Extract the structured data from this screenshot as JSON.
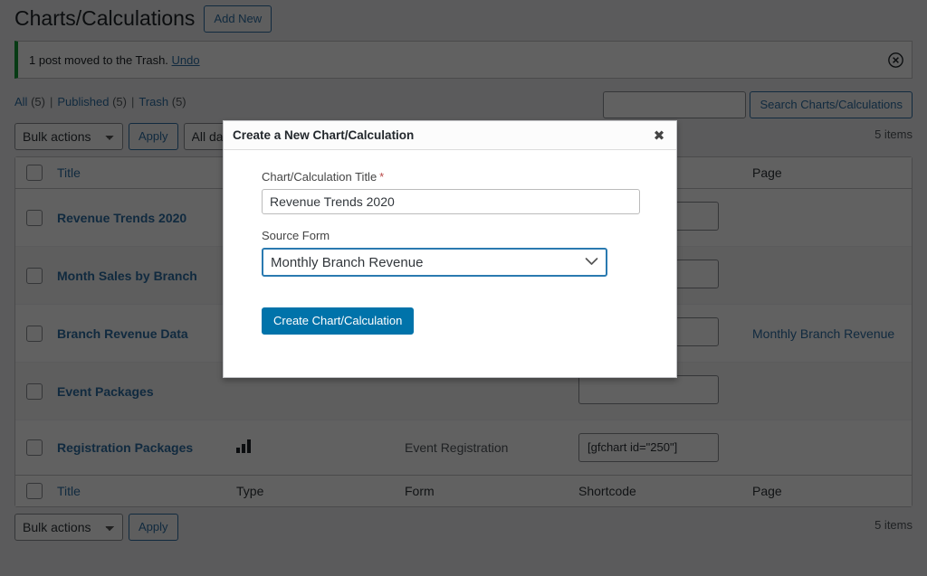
{
  "header": {
    "title": "Charts/Calculations",
    "add_new_label": "Add New"
  },
  "notice": {
    "message": "1 post moved to the Trash.",
    "undo_label": "Undo",
    "dismiss_icon": "dismiss-circle-icon",
    "accent_color": "#00a32a"
  },
  "views": {
    "all_label": "All",
    "all_count": "(5)",
    "published_label": "Published",
    "published_count": "(5)",
    "trash_label": "Trash",
    "trash_count": "(5)",
    "separator": "|"
  },
  "search": {
    "value": "",
    "placeholder": "",
    "button_label": "Search Charts/Calculations"
  },
  "tablenav_top": {
    "bulk_actions_label": "Bulk actions",
    "apply_label": "Apply",
    "dates_label": "All dates",
    "items_count": "5 items"
  },
  "tablenav_bottom": {
    "bulk_actions_label": "Bulk actions",
    "apply_label": "Apply",
    "items_count": "5 items"
  },
  "table": {
    "columns": [
      {
        "key": "title",
        "label": "Title"
      },
      {
        "key": "type",
        "label": "Type"
      },
      {
        "key": "form",
        "label": "Form"
      },
      {
        "key": "shortcode",
        "label": "Shortcode"
      },
      {
        "key": "page",
        "label": "Page"
      }
    ],
    "rows": [
      {
        "title": "Revenue Trends 2020",
        "type_icon": "",
        "form": "",
        "shortcode": "",
        "page": ""
      },
      {
        "title": "Month Sales by Branch",
        "type_icon": "",
        "form": "",
        "shortcode": "",
        "page": ""
      },
      {
        "title": "Branch Revenue Data",
        "type_icon": "",
        "form": "",
        "shortcode": "",
        "page": "Monthly Branch Revenue"
      },
      {
        "title": "Event Packages",
        "type_icon": "",
        "form": "",
        "shortcode": "",
        "page": ""
      },
      {
        "title": "Registration Packages",
        "type_icon": "bar-chart-icon",
        "form": "Event Registration",
        "shortcode": "[gfchart id=\"250\"]",
        "page": ""
      }
    ]
  },
  "modal": {
    "title": "Create a New Chart/Calculation",
    "close_icon": "close-icon",
    "title_field": {
      "label": "Chart/Calculation Title",
      "required_marker": "*",
      "value": "Revenue Trends 2020",
      "placeholder": ""
    },
    "source_form_field": {
      "label": "Source Form",
      "value": "Monthly Branch Revenue",
      "chevron_icon": "chevron-down-icon"
    },
    "submit_label": "Create Chart/Calculation",
    "accent_color": "#0073aa"
  }
}
